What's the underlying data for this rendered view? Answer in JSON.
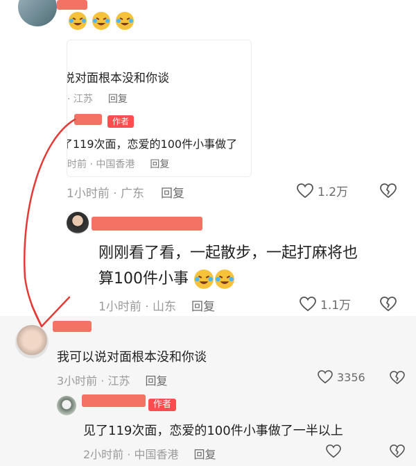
{
  "top_comment": {
    "emoji_count": 3
  },
  "quoted_card": {
    "reply_text": "说对面根本没和你谈",
    "reply_location": "· 江苏",
    "reply_label": "回复",
    "author_badge": "作者",
    "author_text": "了119次面，恋爱的100件小事做了",
    "author_meta": "时前 · 中国香港",
    "author_reply_label": "回复"
  },
  "parent_meta": {
    "time_location": "1小时前 · 广东",
    "reply_label": "回复",
    "like_count": "1.2万"
  },
  "comment_1": {
    "text_line1": "刚刚看了看，一起散步，一起打麻将也",
    "text_line2": "算100件小事",
    "time_location": "1小时前 · 山东",
    "reply_label": "回复",
    "like_count": "1.1万"
  },
  "comment_2": {
    "text": "我可以说对面根本没和你谈",
    "time_location": "3小时前 · 江苏",
    "reply_label": "回复",
    "like_count": "3356"
  },
  "comment_3": {
    "author_badge": "作者",
    "text": "见了119次面，恋爱的100件小事做了一半以上",
    "time_location": "2小时前 · 中国香港",
    "reply_label": "回复"
  },
  "colors": {
    "accent_red": "#ff4d4f",
    "redaction": "#f26a5c",
    "meta_gray": "#9a9a9a"
  }
}
